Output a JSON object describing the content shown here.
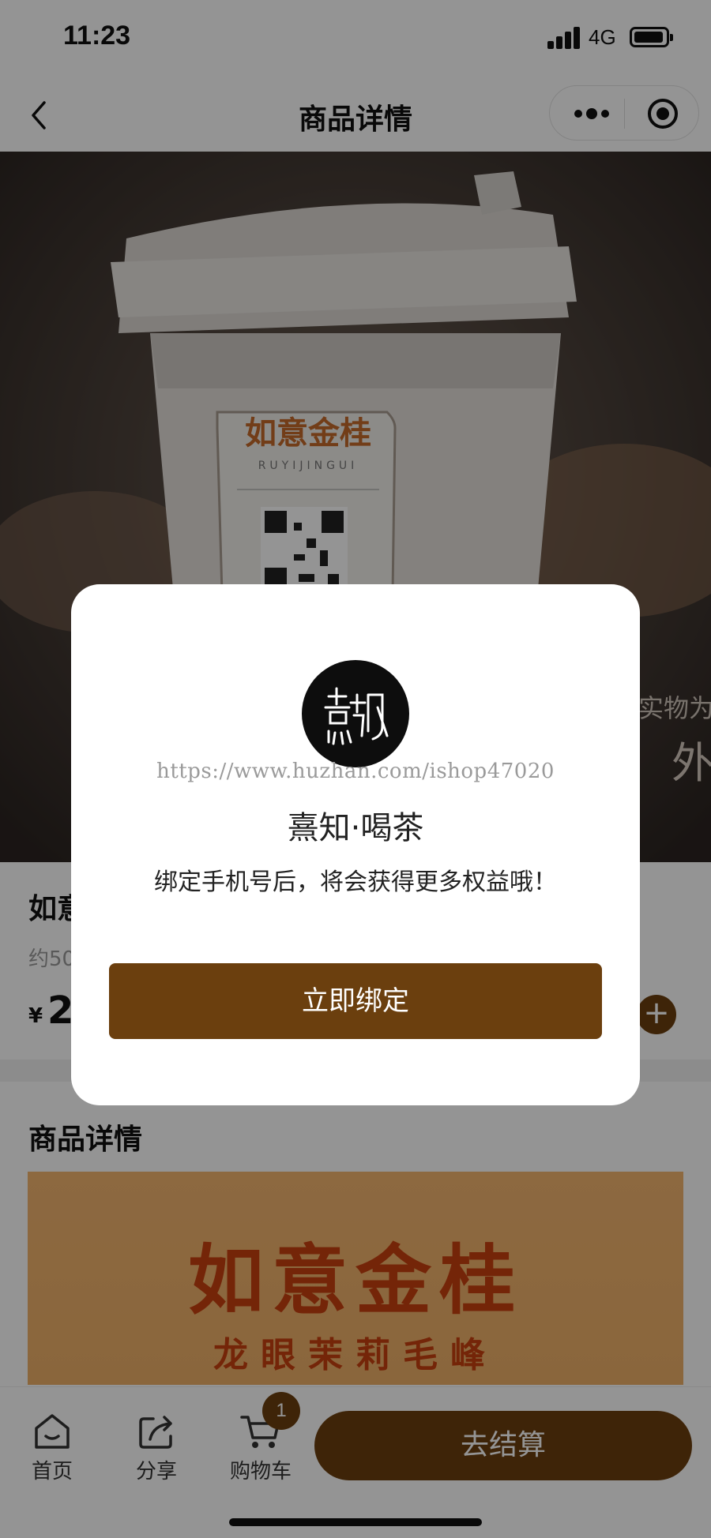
{
  "status_bar": {
    "time": "11:23",
    "network": "4G"
  },
  "nav": {
    "title": "商品详情",
    "icons": [
      "back-chevron-icon",
      "more-dots-icon",
      "target-circle-icon"
    ]
  },
  "hero": {
    "cup_brand_text": "如意金桂",
    "cup_pinyin_text": "RUYIJINGUI",
    "side_text_1": "实物为",
    "side_text_2": "外"
  },
  "product": {
    "name_visible": "如意",
    "spec_visible": "约50",
    "currency": "¥",
    "price_visible": "2",
    "add_label": "+"
  },
  "details": {
    "title": "商品详情",
    "banner_title": "如意金桂",
    "banner_subtitle": "龙眼茉莉毛峰"
  },
  "bottom_bar": {
    "tabs": [
      {
        "label": "首页",
        "icon": "home-icon"
      },
      {
        "label": "分享",
        "icon": "share-icon"
      },
      {
        "label": "购物车",
        "icon": "cart-icon"
      }
    ],
    "cart_badge": "1",
    "checkout_label": "去结算"
  },
  "dialog": {
    "watermark": "https://www.huzhan.com/ishop47020",
    "brand": "熹知·喝茶",
    "message": "绑定手机号后，将会获得更多权益哦！",
    "bind_button": "立即绑定"
  },
  "colors": {
    "accent": "#6b3f0e",
    "banner_bg": "#f3b56f",
    "banner_text": "#c8400f"
  }
}
